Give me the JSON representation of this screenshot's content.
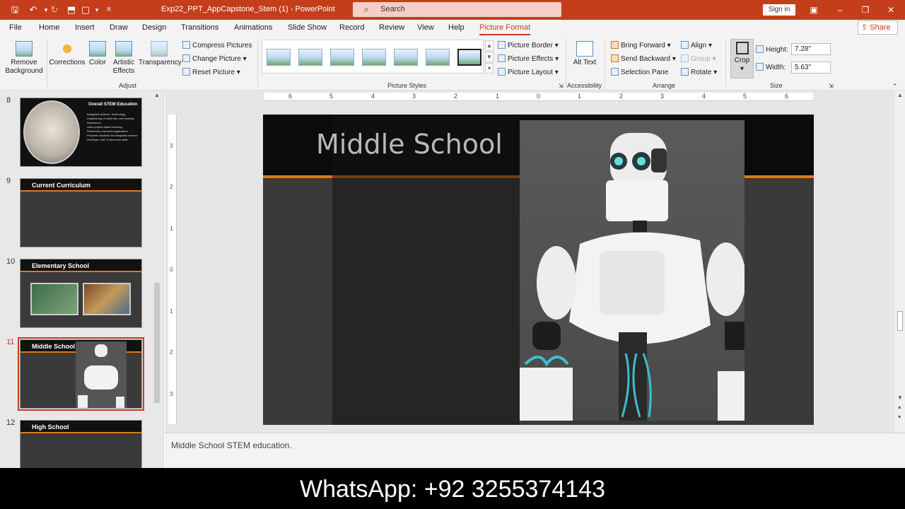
{
  "titlebar": {
    "doc_title": "Exp22_PPT_AppCapstone_Stem (1)  -  PowerPoint",
    "search_placeholder": "Search",
    "signin": "Sign in"
  },
  "tabs": [
    "File",
    "Home",
    "Insert",
    "Draw",
    "Design",
    "Transitions",
    "Animations",
    "Slide Show",
    "Record",
    "Review",
    "View",
    "Help",
    "Picture Format"
  ],
  "active_tab": "Picture Format",
  "share": "Share",
  "ribbon": {
    "remove_bg": "Remove Background",
    "corrections": "Corrections",
    "color": "Color",
    "artistic": "Artistic Effects",
    "transparency": "Transparency",
    "compress": "Compress Pictures",
    "change": "Change Picture",
    "reset": "Reset Picture",
    "group_adjust": "Adjust",
    "group_styles": "Picture Styles",
    "border": "Picture Border",
    "effects": "Picture Effects",
    "layout": "Picture Layout",
    "alt_text": "Alt Text",
    "group_access": "Accessibility",
    "bring_forward": "Bring Forward",
    "send_backward": "Send Backward",
    "selection_pane": "Selection Pane",
    "align": "Align",
    "group": "Group",
    "rotate": "Rotate",
    "group_arrange": "Arrange",
    "crop": "Crop",
    "height_label": "Height:",
    "height_value": "7.28\"",
    "width_label": "Width:",
    "width_value": "5.63\"",
    "group_size": "Size"
  },
  "slides": [
    {
      "num": "8",
      "title": "Overall STEM Education"
    },
    {
      "num": "9",
      "title": "Current Curriculum"
    },
    {
      "num": "10",
      "title": "Elementary School"
    },
    {
      "num": "11",
      "title": "Middle School"
    },
    {
      "num": "12",
      "title": "High School"
    }
  ],
  "slide8_bullets": [
    "Integrates science, technology, engineering, & math into one learning experience",
    "Uses project-based learning",
    "Reinforces real world application",
    "Prepares students for integrated careers",
    "Develops \"soft\" & technical skills"
  ],
  "ruler_h": [
    "6",
    "5",
    "4",
    "3",
    "2",
    "1",
    "0",
    "1",
    "2",
    "3",
    "4",
    "5",
    "6"
  ],
  "ruler_v": [
    "3",
    "2",
    "1",
    "0",
    "1",
    "2",
    "3"
  ],
  "slide_title": "Middle School",
  "notes": "Middle School STEM education.",
  "banner": "WhatsApp: +92 3255374143",
  "colors": {
    "accent": "#c43e1c",
    "slide_orange": "#e07a10"
  }
}
